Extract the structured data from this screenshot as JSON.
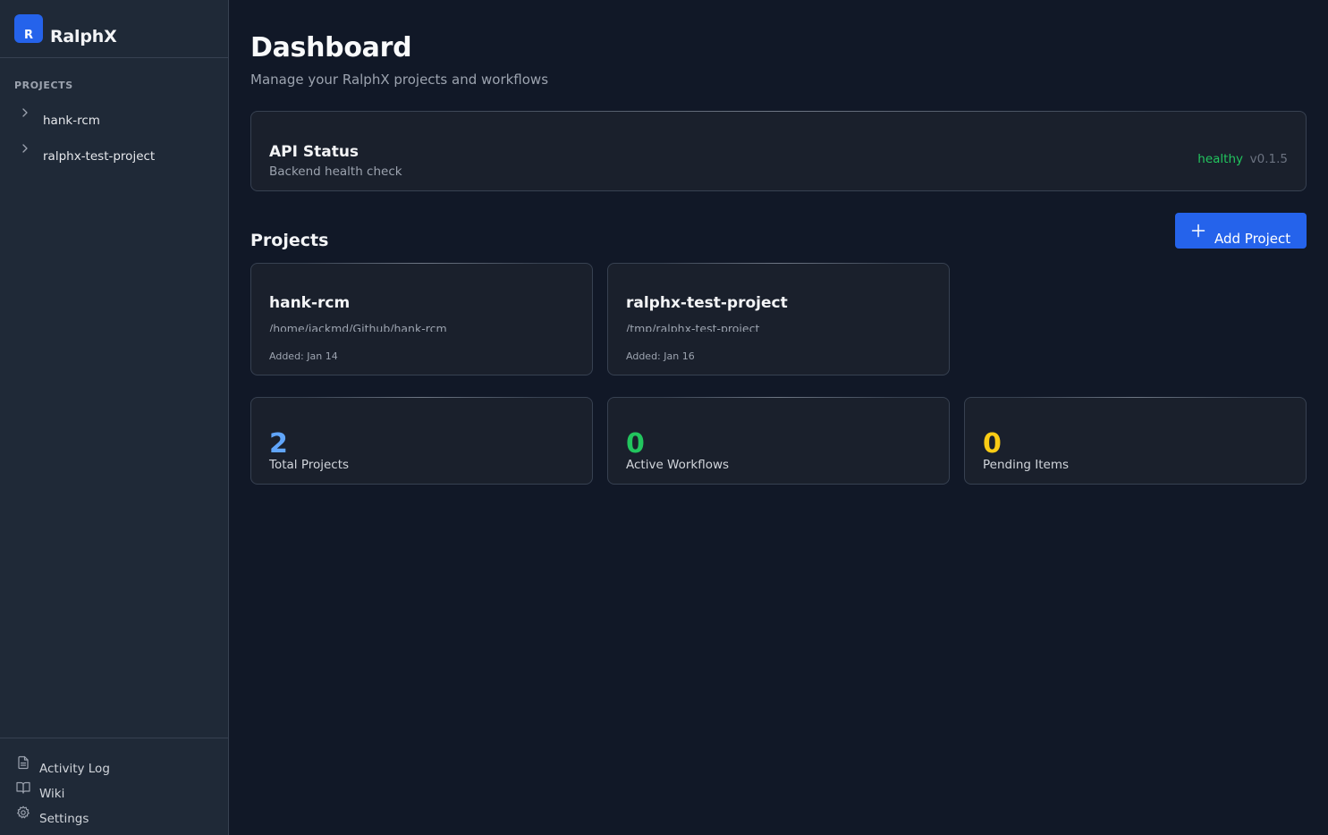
{
  "app": {
    "name": "RalphX",
    "logo_letter": "R"
  },
  "sidebar": {
    "section_label": "PROJECTS",
    "projects": [
      {
        "label": "hank-rcm"
      },
      {
        "label": "ralphx-test-project"
      }
    ],
    "bottom_items": [
      {
        "label": "Activity Log",
        "icon": "file-text-icon"
      },
      {
        "label": "Wiki",
        "icon": "book-open-icon"
      },
      {
        "label": "Settings",
        "icon": "gear-icon"
      }
    ]
  },
  "header": {
    "title": "Dashboard",
    "subtitle": "Manage your RalphX projects and workflows"
  },
  "api_status": {
    "title": "API Status",
    "subtitle": "Backend health check",
    "status": "healthy",
    "version": "v0.1.5"
  },
  "projects_section": {
    "title": "Projects",
    "add_button_label": "Add Project",
    "cards": [
      {
        "name": "hank-rcm",
        "path": "/home/jackmd/Github/hank-rcm",
        "added": "Added: Jan 14"
      },
      {
        "name": "ralphx-test-project",
        "path": "/tmp/ralphx-test-project",
        "added": "Added: Jan 16"
      }
    ]
  },
  "stats": [
    {
      "value": "2",
      "label": "Total Projects"
    },
    {
      "value": "0",
      "label": "Active Workflows"
    },
    {
      "value": "0",
      "label": "Pending Items"
    }
  ],
  "colors": {
    "background": "#111827",
    "sidebar": "#1f2937",
    "card": "#1a202c",
    "border": "#374151",
    "accent": "#2563eb",
    "status_healthy": "#22c55e",
    "stat_projects": "#60a5fa",
    "stat_workflows": "#22c55e",
    "stat_pending": "#facc15"
  }
}
